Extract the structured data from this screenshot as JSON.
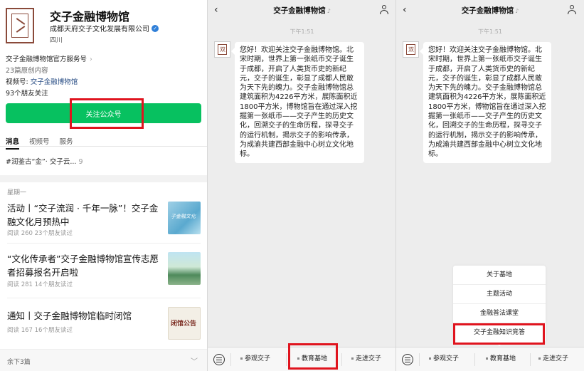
{
  "profile": {
    "name": "交子金融博物馆",
    "company": "成都天府交子文化发展有限公司",
    "location": "四川",
    "service_link": "交子金融博物馆官方服务号",
    "originals": "23篇原创内容",
    "video_prefix": "视频号: ",
    "video_name": "交子金融博物馆",
    "friends_follow": "93个朋友关注",
    "follow_button": "关注公众号",
    "tabs": [
      "消息",
      "视频号",
      "服务"
    ],
    "preview": "#润鉴古“金”· 交子云...",
    "preview_count": "9"
  },
  "articles": {
    "day_label": "星期一",
    "items": [
      {
        "title": "活动丨“交子流润 · 千年一脉”！交子金融文化月预热中",
        "stats": "阅读 260  23个朋友读过",
        "thumb_text": "子金融文化"
      },
      {
        "title": "“文化传承者”交子金融博物馆宣传志愿者招募报名开启啦",
        "stats": "阅读 281  14个朋友读过",
        "thumb_text": ""
      },
      {
        "title": "通知丨交子金融博物馆临时闭馆",
        "stats": "阅读 167  16个朋友读过",
        "thumb_text": "闭馆公告"
      }
    ],
    "more": "余下3篇"
  },
  "chat": {
    "title": "交子金融博物馆",
    "time": "下午1:51",
    "message": "您好！欢迎关注交子金融博物馆。北宋时期，世界上第一张纸币交子诞生于成都，开启了人类货币史的新纪元，交子的诞生，彰显了成都人民敢为天下先的魄力。交子金融博物馆总建筑面积为4226平方米，展陈面积近1800平方米，博物馆旨在通过深入挖掘第一张纸币——交子产生的历史文化，回溯交子的生命历程，探寻交子的运行机制，揭示交子的影响传承，为成渝共建西部金融中心树立文化地标。",
    "menu": [
      "参观交子",
      "教育基地",
      "走进交子"
    ],
    "submenu": [
      "关于基地",
      "主题活动",
      "金融普法课堂",
      "交子金融知识竞答"
    ]
  },
  "colors": {
    "wechat_green": "#07c160",
    "highlight_red": "#e0141e",
    "brand_brown": "#8a4a3a"
  }
}
